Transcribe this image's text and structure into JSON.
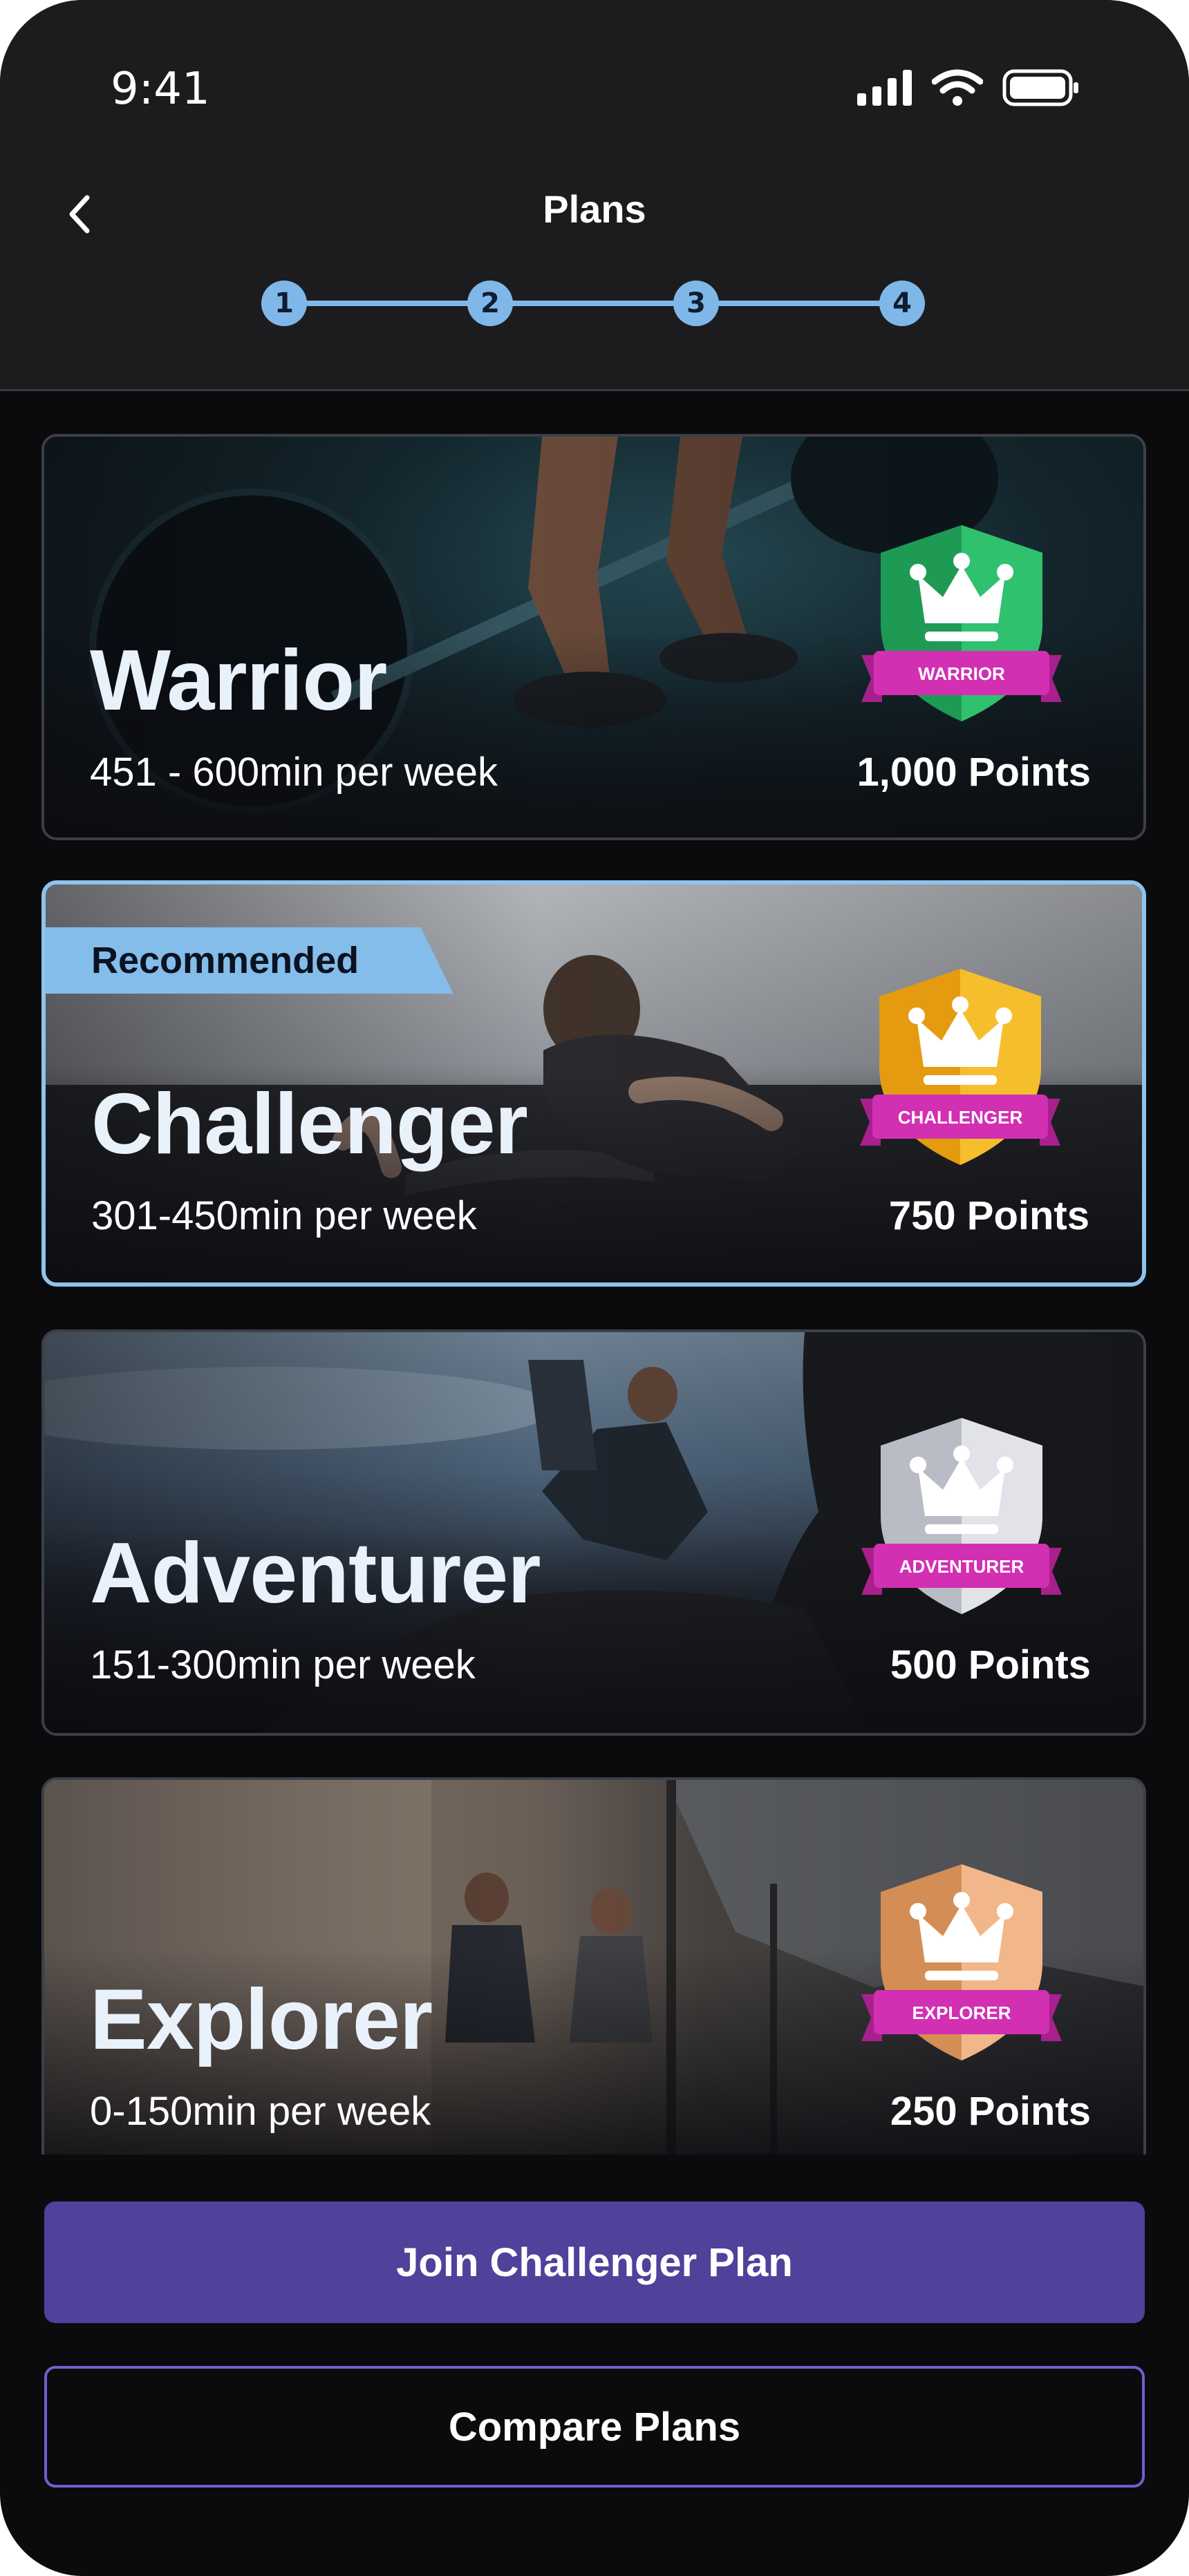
{
  "status_bar": {
    "time": "9:41",
    "icons": [
      "signal-icon",
      "wifi-icon",
      "battery-icon"
    ]
  },
  "header": {
    "title": "Plans",
    "back_icon": "chevron-left-icon"
  },
  "stepper": {
    "steps": [
      "1",
      "2",
      "3",
      "4"
    ],
    "color": "#7fb8e8"
  },
  "plans": [
    {
      "name": "Warrior",
      "minutes": "451 - 600min per week",
      "points": "1,000 Points",
      "badge_label": "WARRIOR",
      "badge_color": "#2fc26f",
      "selected": false
    },
    {
      "name": "Challenger",
      "minutes": "301-450min per week",
      "points": "750 Points",
      "badge_label": "CHALLENGER",
      "badge_color": "#f2b21c",
      "selected": true,
      "tag": "Recommended"
    },
    {
      "name": "Adventurer",
      "minutes": "151-300min per week",
      "points": "500 Points",
      "badge_label": "ADVENTURER",
      "badge_color": "#d9dce3",
      "selected": false
    },
    {
      "name": "Explorer",
      "minutes": "0-150min per week",
      "points": "250 Points",
      "badge_label": "EXPLORER",
      "badge_color": "#f0b27e",
      "selected": false
    }
  ],
  "actions": {
    "primary": "Join Challenger Plan",
    "secondary": "Compare Plans"
  },
  "colors": {
    "accent": "#50419b",
    "selected_border": "#8fc3ee",
    "ribbon": "#d22fb3"
  }
}
